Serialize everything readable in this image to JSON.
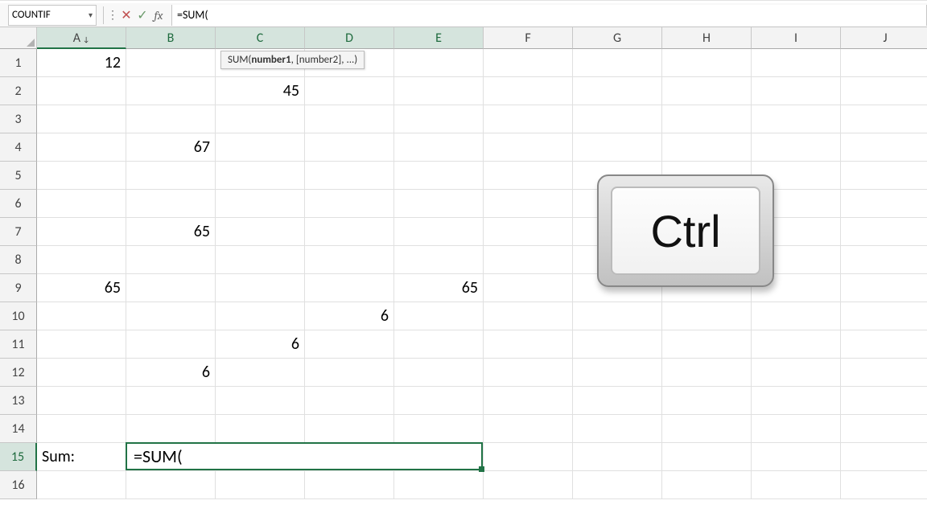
{
  "namebox": {
    "value": "COUNTIF"
  },
  "fbar": {
    "cancel_glyph": "✕",
    "enter_glyph": "✓",
    "fx_glyph": "fx",
    "formula": "=SUM("
  },
  "tooltip": {
    "fn": "SUM(",
    "arg1": "number1",
    "rest": ", [number2], ...)"
  },
  "columns": [
    "A",
    "B",
    "C",
    "D",
    "E",
    "F",
    "G",
    "H",
    "I",
    "J"
  ],
  "col_filter": {
    "index": 0,
    "glyph": "↓"
  },
  "selected_col_index": 0,
  "highlight_col_indices": [
    1,
    2,
    3,
    4
  ],
  "rows": 16,
  "highlight_row": 15,
  "cells": {
    "A1": {
      "text": "12",
      "align": "num"
    },
    "C2": {
      "text": "45",
      "align": "num"
    },
    "B4": {
      "text": "67",
      "align": "num"
    },
    "B7": {
      "text": "65",
      "align": "num"
    },
    "A9": {
      "text": "65",
      "align": "num"
    },
    "E9": {
      "text": "65",
      "align": "num"
    },
    "D10": {
      "text": "6",
      "align": "num"
    },
    "C11": {
      "text": "6",
      "align": "num"
    },
    "B12": {
      "text": "6",
      "align": "num"
    },
    "A15": {
      "text": "Sum:",
      "align": "txt"
    }
  },
  "editing": {
    "ref": "B15:E15",
    "value": "=SUM("
  },
  "keycap": {
    "label": "Ctrl"
  }
}
